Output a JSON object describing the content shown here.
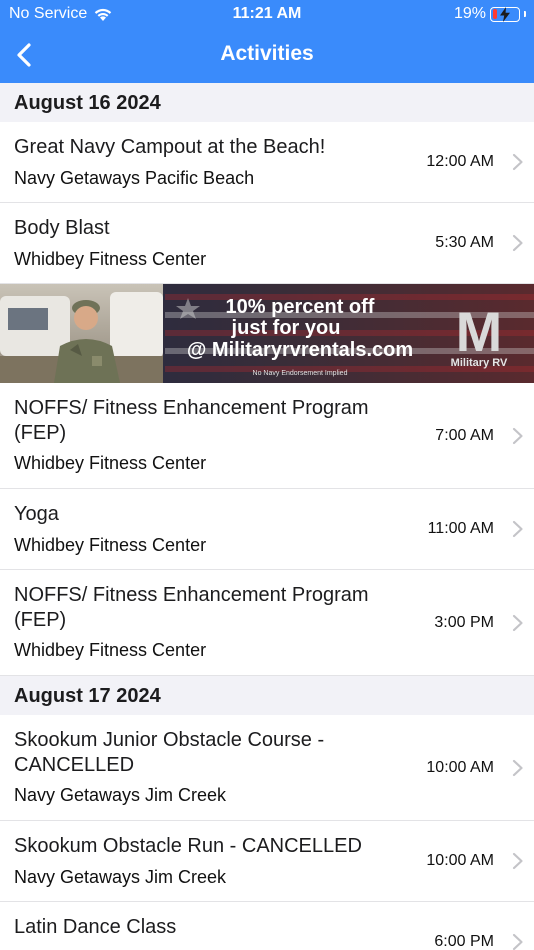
{
  "status_bar": {
    "carrier": "No Service",
    "time": "11:21 AM",
    "battery": "19%",
    "battery_level": 0.19
  },
  "nav": {
    "title": "Activities"
  },
  "sections": [
    {
      "date": "August 16 2024",
      "items": [
        {
          "title": "Great Navy Campout at the Beach!",
          "location": "Navy Getaways Pacific Beach",
          "time": "12:00 AM"
        },
        {
          "title": "Body Blast",
          "location": "Whidbey Fitness Center",
          "time": "5:30 AM"
        },
        {
          "title": "NOFFS/ Fitness Enhancement Program (FEP)",
          "location": "Whidbey Fitness Center",
          "time": "7:00 AM"
        },
        {
          "title": "Yoga",
          "location": "Whidbey Fitness Center",
          "time": "11:00 AM"
        },
        {
          "title": "NOFFS/ Fitness Enhancement Program (FEP)",
          "location": "Whidbey Fitness Center",
          "time": "3:00 PM"
        }
      ]
    },
    {
      "date": "August 17 2024",
      "items": [
        {
          "title": "Skookum Junior Obstacle Course - CANCELLED",
          "location": "Navy Getaways Jim Creek",
          "time": "10:00 AM"
        },
        {
          "title": "Skookum Obstacle Run - CANCELLED",
          "location": "Navy Getaways Jim Creek",
          "time": "10:00 AM"
        },
        {
          "title": "Latin Dance Class",
          "location": "",
          "time": "6:00 PM"
        }
      ]
    }
  ],
  "ad_banner": {
    "line1": "10% percent off",
    "line2": "just for you",
    "line3": "@ Militaryrvrentals.com",
    "disclaimer": "No Navy Endorsement Implied",
    "logo_letter": "M",
    "logo_text": "Military RV"
  },
  "colors": {
    "header": "#3a8bfb",
    "section_bg": "#f2f2f7",
    "battery_low": "#ff3b30"
  }
}
